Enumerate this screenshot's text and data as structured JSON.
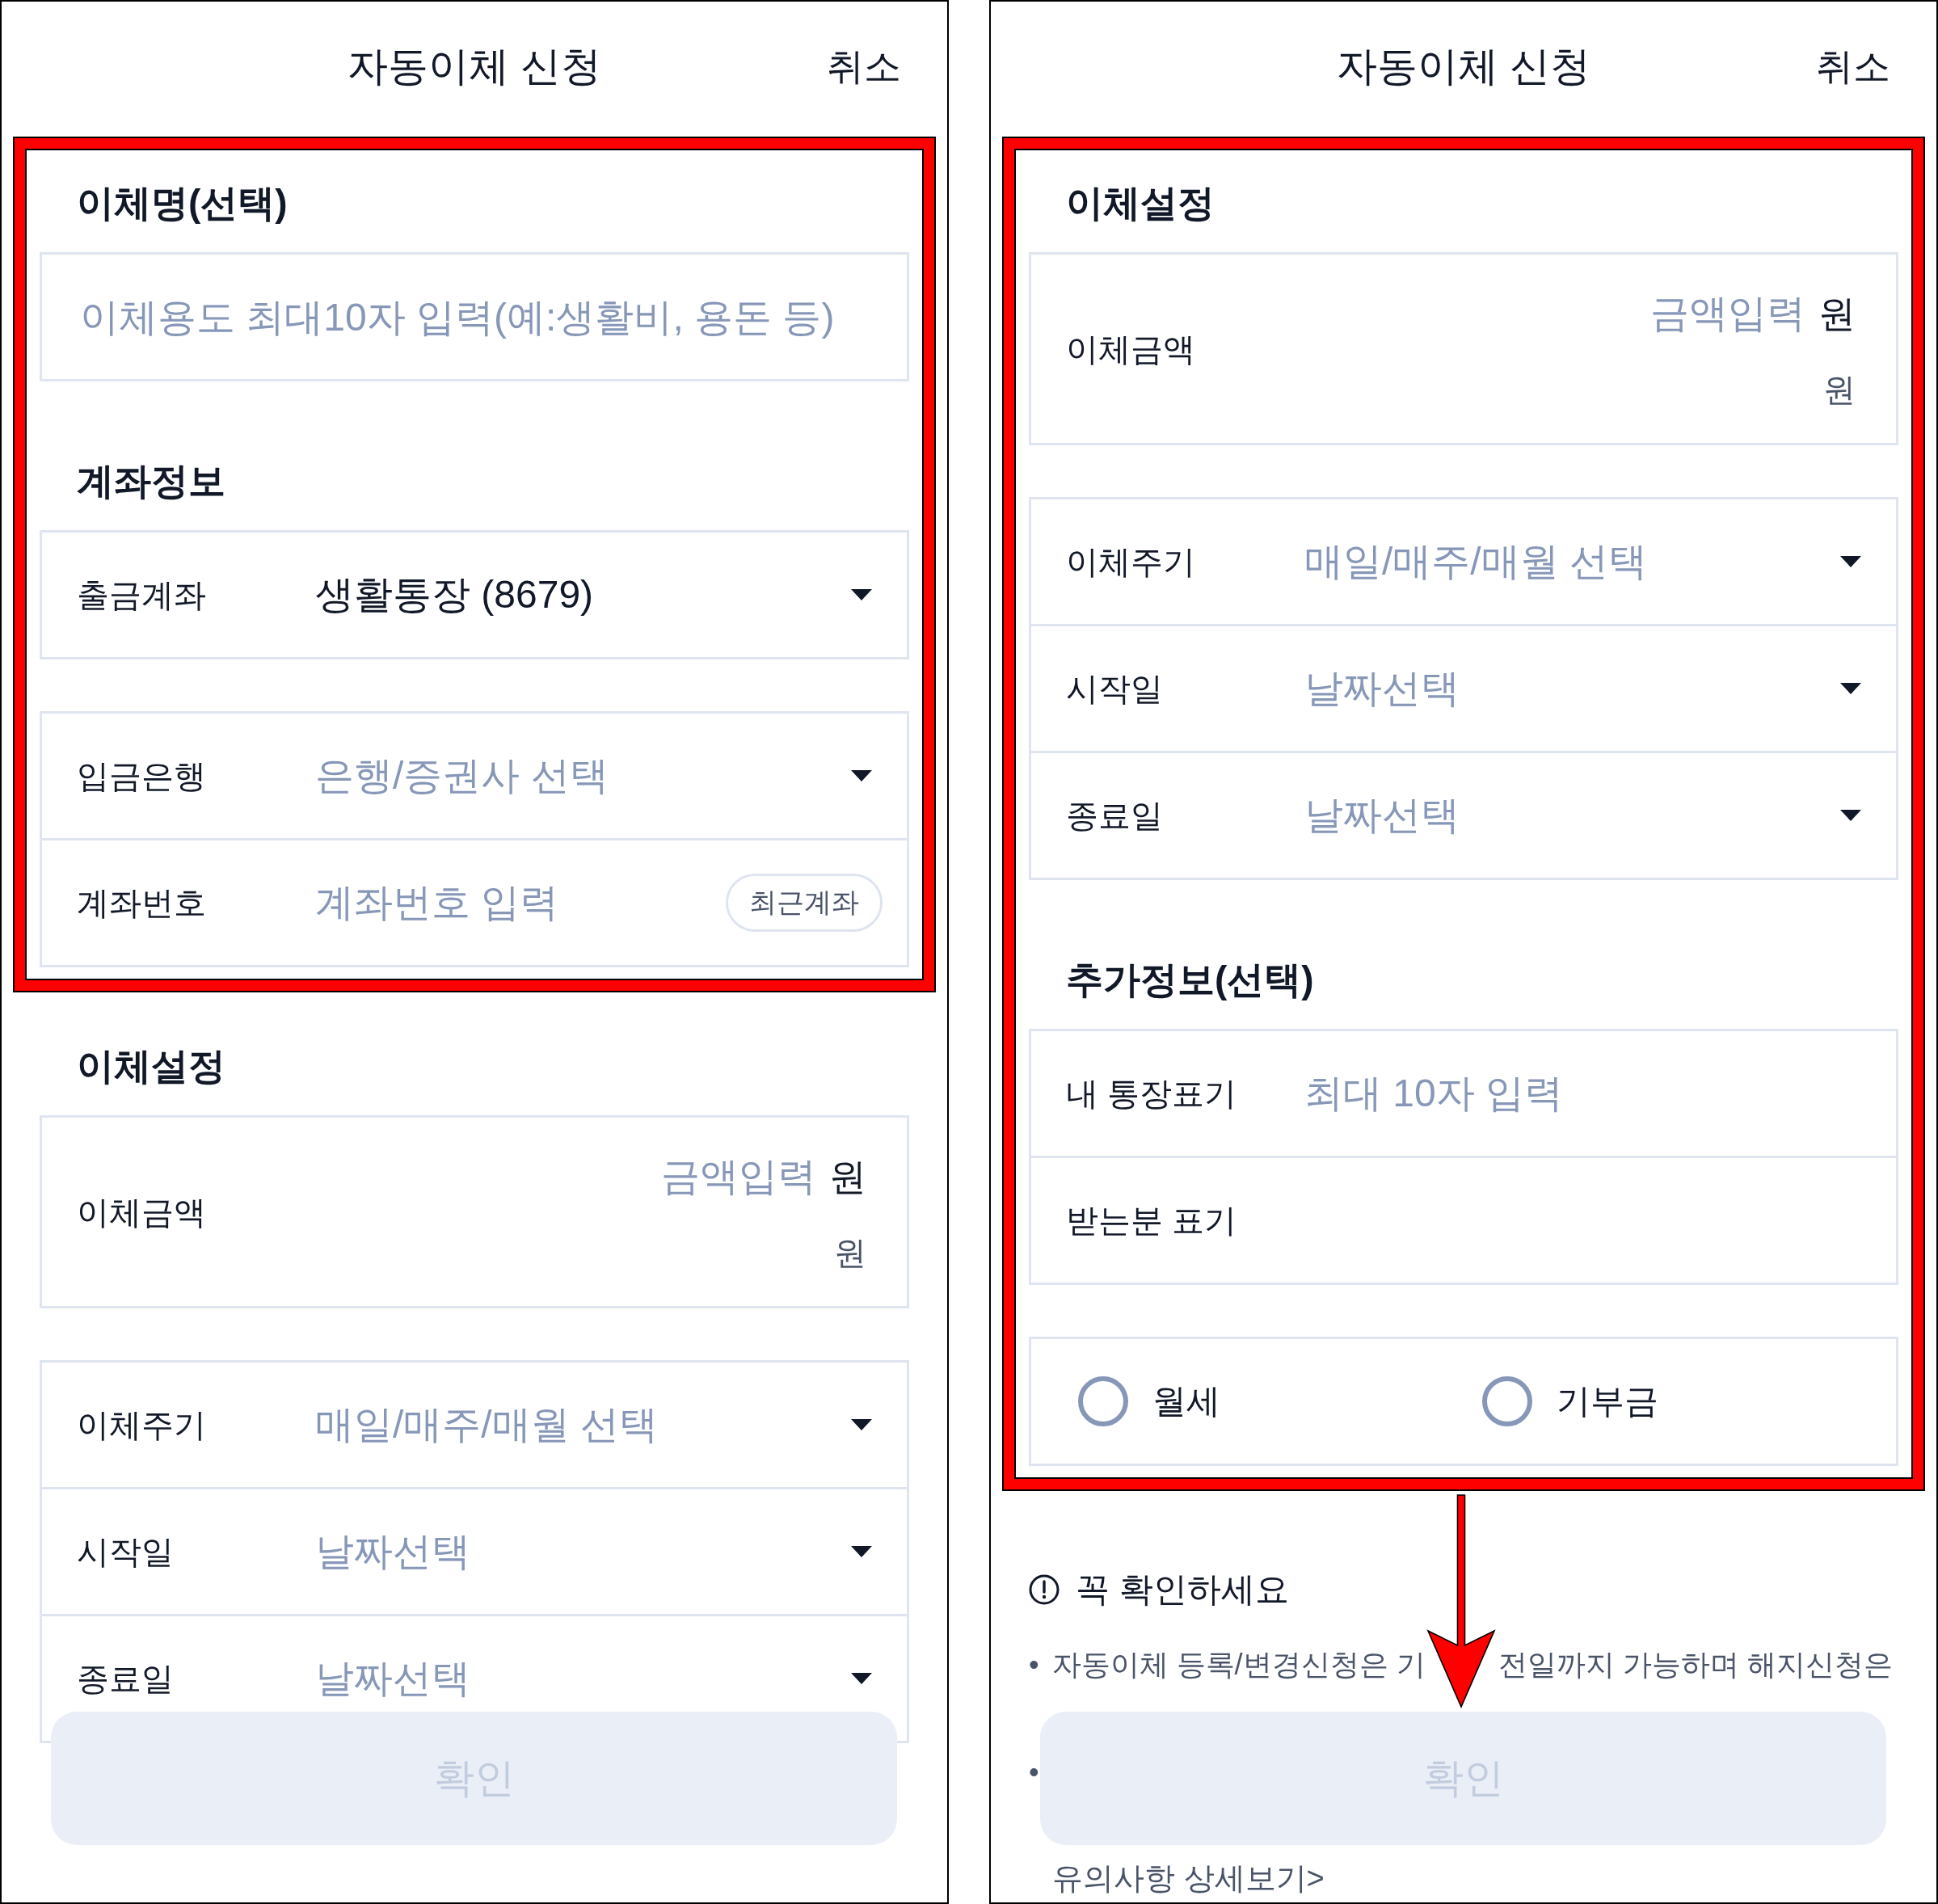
{
  "panels": [
    {
      "header": {
        "title": "자동이체 신청",
        "cancel": "취소"
      },
      "sections": [
        {
          "title": "이체명(선택)",
          "highlighted": true,
          "groups": [
            [
              {
                "kind": "input",
                "placeholder": "이체용도 최대10자 입력(예:생활비, 용돈 등)"
              }
            ]
          ]
        },
        {
          "title": "계좌정보",
          "highlighted": true,
          "groups": [
            [
              {
                "kind": "select",
                "label": "출금계좌",
                "value": "생활통장 (8679)"
              }
            ],
            [
              {
                "kind": "select",
                "label": "입금은행",
                "placeholder": "은행/증권사 선택"
              },
              {
                "kind": "input",
                "label": "계좌번호",
                "placeholder": "계좌번호 입력",
                "action": "최근계좌"
              }
            ]
          ]
        },
        {
          "title": "이체설정",
          "highlighted": false,
          "groups": [
            [
              {
                "kind": "amount",
                "label": "이체금액",
                "placeholder": "금액입력",
                "unit": "원",
                "note": "원"
              }
            ],
            [
              {
                "kind": "select",
                "label": "이체주기",
                "placeholder": "매일/매주/매월 선택"
              },
              {
                "kind": "select",
                "label": "시작일",
                "placeholder": "날짜선택"
              },
              {
                "kind": "select",
                "label": "종료일",
                "placeholder": "날짜선택"
              }
            ]
          ]
        }
      ],
      "confirm_button": {
        "label": "확인",
        "disabled": true
      }
    },
    {
      "header": {
        "title": "자동이체 신청",
        "cancel": "취소"
      },
      "sections": [
        {
          "title": "이체설정",
          "highlighted": true,
          "groups": [
            [
              {
                "kind": "amount",
                "label": "이체금액",
                "placeholder": "금액입력",
                "unit": "원",
                "note": "원"
              }
            ],
            [
              {
                "kind": "select",
                "label": "이체주기",
                "placeholder": "매일/매주/매월 선택"
              },
              {
                "kind": "select",
                "label": "시작일",
                "placeholder": "날짜선택"
              },
              {
                "kind": "select",
                "label": "종료일",
                "placeholder": "날짜선택"
              }
            ]
          ]
        },
        {
          "title": "추가정보(선택)",
          "highlighted": true,
          "groups": [
            [
              {
                "kind": "input",
                "label": "내 통장표기",
                "placeholder": "최대 10자 입력"
              },
              {
                "kind": "input",
                "label": "받는분 표기"
              }
            ],
            [
              {
                "kind": "radios",
                "options": [
                  {
                    "label": "월세",
                    "selected": false
                  },
                  {
                    "label": "기부금",
                    "selected": false
                  }
                ]
              }
            ]
          ]
        }
      ],
      "notice": {
        "title": "꼭 확인하세요",
        "items": [
          {
            "bullet": "•",
            "parts": [
              "자동이체 등록/변경신청은 기",
              "전일까지 가능하며 해지신청은"
            ]
          },
          {
            "bullet": "•"
          }
        ],
        "link": "유의사항 상세보기>"
      },
      "pointer_arrow": true,
      "confirm_button": {
        "label": "확인",
        "disabled": true
      }
    }
  ]
}
